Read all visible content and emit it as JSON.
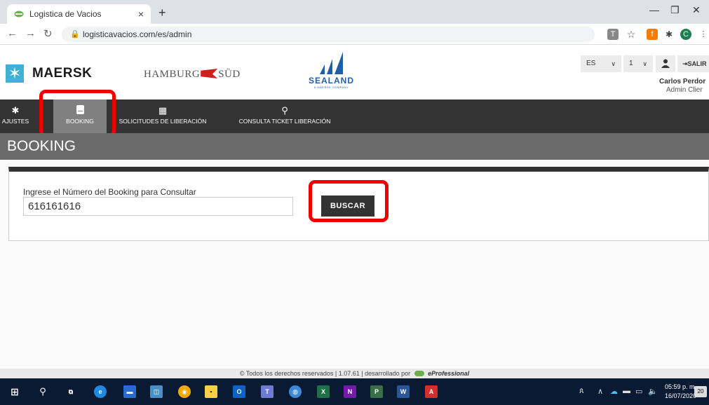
{
  "browser": {
    "tab_title": "Logistica de Vacios",
    "tab_close": "×",
    "new_tab": "+",
    "url": "logisticavacios.com/es/admin",
    "profile_initial": "C"
  },
  "header": {
    "brand_maersk": "MAERSK",
    "brand_hamburg_left": "HAMBURG",
    "brand_hamburg_right": "SÜD",
    "brand_sealand": "SEALAND",
    "brand_sealand_sub": "A MAERSK COMPANY",
    "language": "ES",
    "page_number": "1",
    "logout_label": "SALIR",
    "user_name": "Carlos Perdor",
    "user_role": "Admin Clier"
  },
  "nav": {
    "items": [
      {
        "label": "AJUSTES",
        "icon": "gear-icon"
      },
      {
        "label": "BOOKING",
        "icon": "booking-icon",
        "active": true
      },
      {
        "label": "SOLICITUDES DE LIBERACIÓN",
        "icon": "calendar-icon"
      },
      {
        "label": "CONSULTA TICKET LIBERACIÓN",
        "icon": "search-icon"
      }
    ]
  },
  "page": {
    "title": "BOOKING",
    "field_label": "Ingrese el Número del Booking para Consultar",
    "booking_value": "616161616",
    "search_button": "BUSCAR"
  },
  "footer": {
    "text": "© Todos los derechos reservados | 1.07.61 | desarrollado por",
    "brand": "eProfessional"
  },
  "taskbar": {
    "time": "05:59 p. m.",
    "date": "16/07/2020",
    "notifications": "20"
  },
  "colors": {
    "nav_bg": "#333333",
    "nav_active": "#808080",
    "title_bar": "#6b6b6b",
    "highlight": "#ee0000",
    "maersk_blue": "#42b0d5",
    "sealand_blue": "#1f5fa8"
  }
}
